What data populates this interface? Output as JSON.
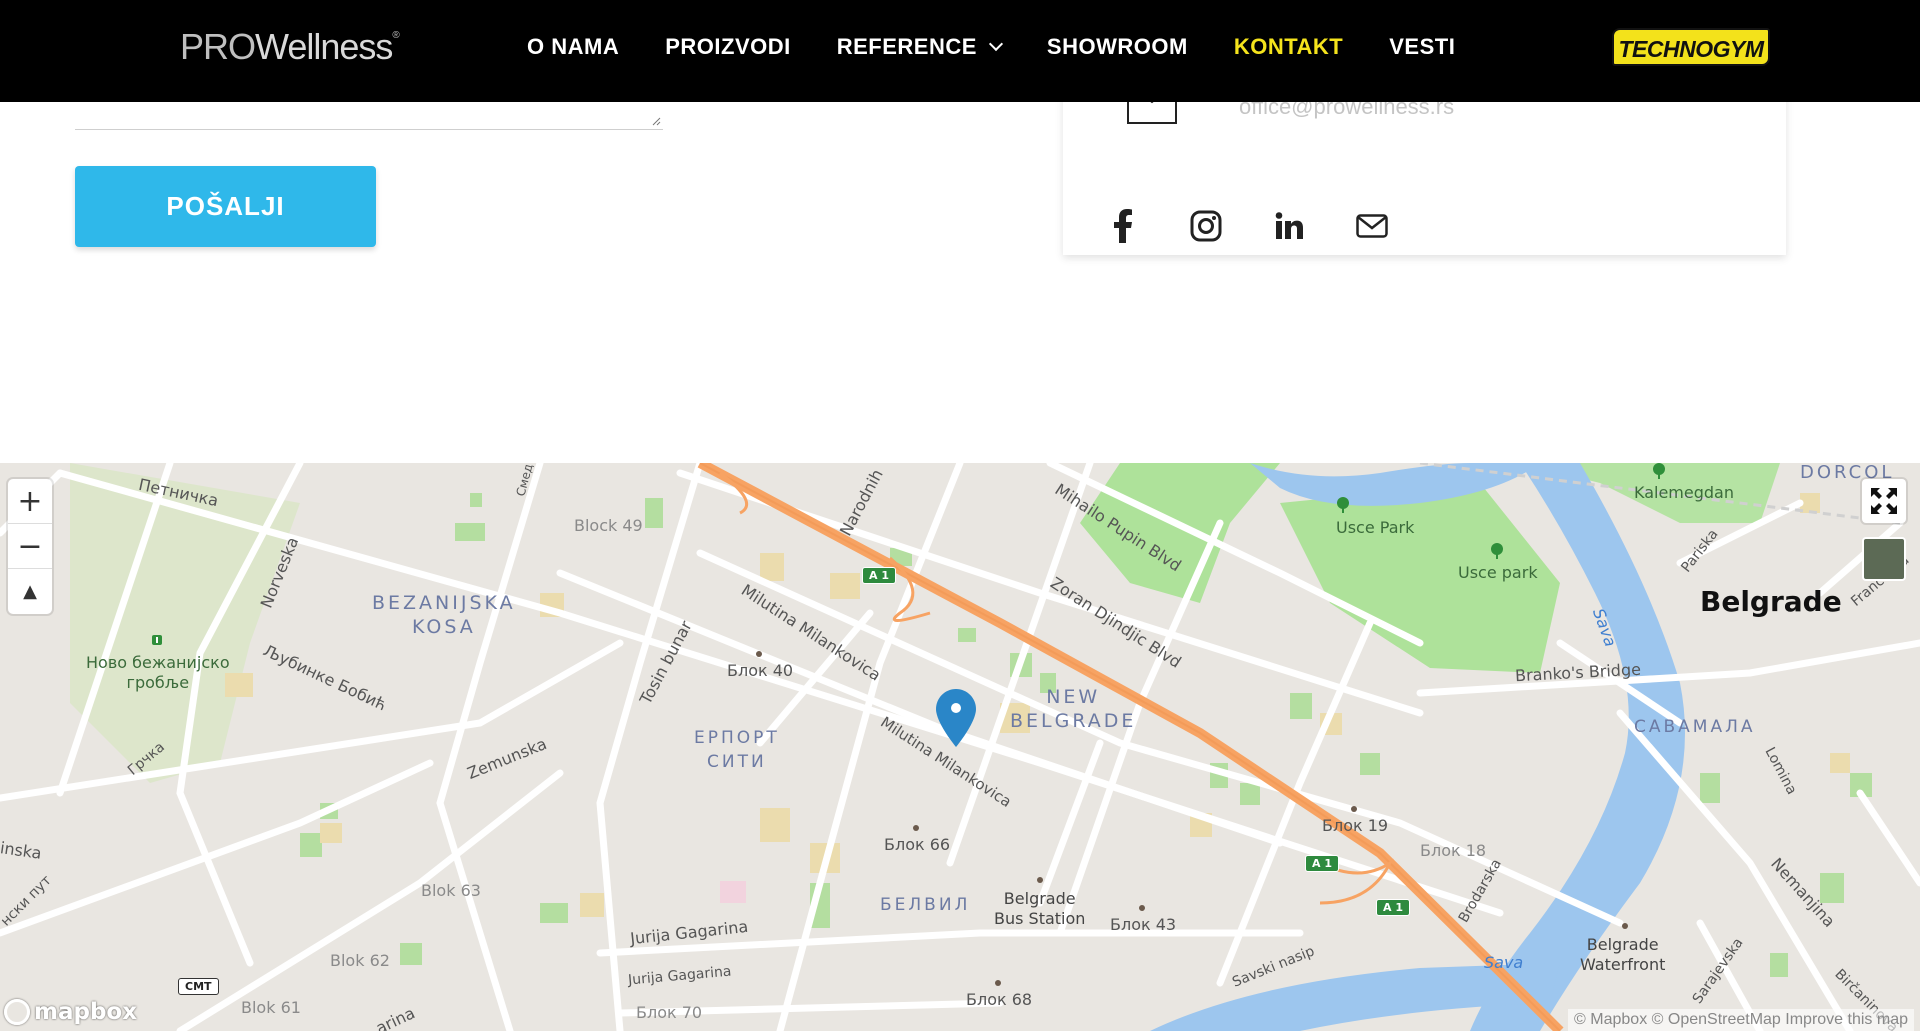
{
  "header": {
    "logo_pro": "PRO",
    "logo_wellness": "Wellness",
    "logo_mark": "®",
    "nav": [
      {
        "label": "O NAMA"
      },
      {
        "label": "PROIZVODI"
      },
      {
        "label": "REFERENCE",
        "has_dropdown": true
      },
      {
        "label": "SHOWROOM"
      },
      {
        "label": "KONTAKT",
        "active": true
      },
      {
        "label": "VESTI"
      }
    ],
    "partner_logo": "TECHNOGYM",
    "active_color": "#f5e31c"
  },
  "form": {
    "submit_label": "POŠALJI",
    "button_color": "#2fb8ea"
  },
  "contact_card": {
    "email": "office@prowellness.rs",
    "social_icons": [
      "facebook-icon",
      "instagram-icon",
      "linkedin-icon",
      "mail-icon"
    ]
  },
  "map": {
    "districts": {
      "bezanijska": "BEZANIJSKA\nKOSA",
      "new_belgrade": "NEW\nBELGRADE",
      "erport": "ЕРПОРТ\nСИТИ",
      "savamala": "САВАМАЛА",
      "belvil": "БЕЛВИЛ",
      "dorcol": "DORCOL"
    },
    "city": "Belgrade",
    "streets": {
      "petnicka": "Петничка",
      "norveska": "Norveska",
      "ljubinke": "Љубинке Бобић",
      "grcka": "Грчка",
      "zemunska": "Zemunska",
      "tosin": "Tosin bunar",
      "milutina1": "Milutina Milankovica",
      "milutina2": "Milutina Milankovica",
      "narodnih": "Narodnih",
      "mihailo": "Mihailo Pupin Blvd",
      "zoran": "Zoran Djindjic Blvd",
      "jurija1": "Jurija Gagarina",
      "jurija2": "Jurija Gagarina",
      "savski": "Savski nasip",
      "brodarska": "Brodarska",
      "nemanjina": "Nemanjina",
      "sarajevska": "Sarajevska",
      "lomina": "Lomina",
      "pariska": "Pariska",
      "francuska": "Francuska",
      "birc": "Birčaninova",
      "branko": "Branko's Bridge",
      "inska": "inska",
      "pul": "нски пут",
      "smed": "Смед",
      "arina": "arina"
    },
    "blocks": {
      "b49": "Block 49",
      "b40": "Блок 40",
      "b66": "Блок 66",
      "b63": "Blok 63",
      "b62": "Blok 62",
      "b61": "Blok 61",
      "b70": "Блок 70",
      "b68": "Блок 68",
      "b43": "Блок 43",
      "b19": "Блок 19",
      "b18": "Блок 18"
    },
    "parks": {
      "kalemegdan": "Kalemegdan",
      "usce_park1": "Usce Park",
      "usce_park2": "Usce park",
      "cemetery": "Ново бежанијско\nгробље"
    },
    "water": {
      "sava1": "Sava",
      "sava2": "Sava"
    },
    "pois": {
      "bus_station": "Belgrade\nBus Station",
      "waterfront": "Belgrade\nWaterfront"
    },
    "shields": {
      "a1_1": "A 1",
      "a1_2": "A 1",
      "a1_3": "A 1",
      "cmt": "CMT"
    },
    "controls": {
      "zoom_in": "+",
      "zoom_out": "−",
      "compass": "▲"
    },
    "branding": "mapbox",
    "attribution": {
      "mapbox": "© Mapbox",
      "osm": "© OpenStreetMap",
      "improve": "Improve this map"
    }
  }
}
